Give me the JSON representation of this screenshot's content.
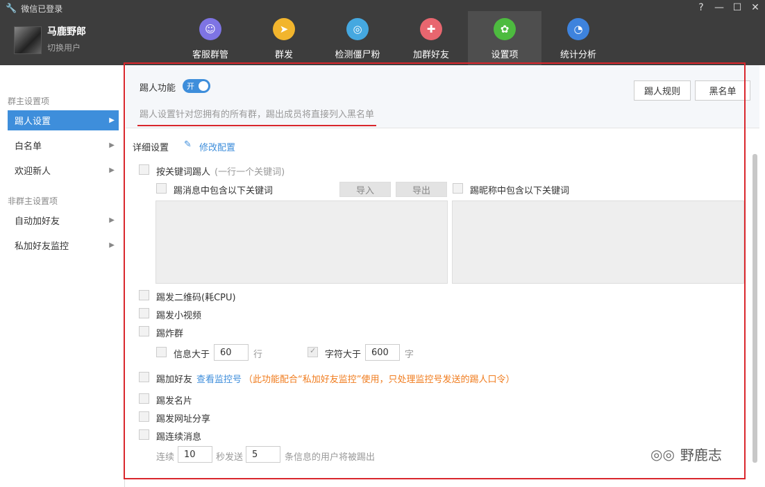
{
  "window": {
    "title": "微信已登录",
    "ctrl_help": "?",
    "ctrl_min": "—",
    "ctrl_max": "☐",
    "ctrl_close": "✕"
  },
  "user": {
    "name": "马鹿野郎",
    "switch": "切换用户"
  },
  "nav": [
    {
      "label": "客服群管",
      "color": "#7e74e4",
      "glyph": "☺"
    },
    {
      "label": "群发",
      "color": "#f2b52d",
      "glyph": "➤"
    },
    {
      "label": "检测僵尸粉",
      "color": "#45a8e0",
      "glyph": "◎"
    },
    {
      "label": "加群好友",
      "color": "#e8666f",
      "glyph": "✚"
    },
    {
      "label": "设置项",
      "color": "#4dbb3f",
      "glyph": "✿"
    },
    {
      "label": "统计分析",
      "color": "#3e83dd",
      "glyph": "◔"
    }
  ],
  "sidebar": {
    "group1": "群主设置项",
    "items1": [
      "踢人设置",
      "白名单",
      "欢迎新人"
    ],
    "group2": "非群主设置项",
    "items2": [
      "自动加好友",
      "私加好友监控"
    ]
  },
  "main": {
    "kick_label": "踢人功能",
    "toggle": "开",
    "rules_btn": "踢人规则",
    "blacklist_btn": "黑名单",
    "desc": "踢人设置针对您拥有的所有群，踢出成员将直接列入黑名单",
    "detail_label": "详细设置",
    "edit_label": "修改配置",
    "kw_kick": "按关键词踢人",
    "kw_hint": "(一行一个关键词)",
    "msg_kw": "踢消息中包含以下关键词",
    "import": "导入",
    "export": "导出",
    "nick_kw": "踢昵称中包含以下关键词",
    "qr": "踢发二维码(耗CPU)",
    "video": "踢发小视频",
    "bomb": "踢炸群",
    "info_gt": "信息大于",
    "info_val": "60",
    "row_unit": "行",
    "char_gt": "字符大于",
    "char_val": "600",
    "char_unit": "字",
    "add_friend": "踢加好友",
    "view_monitor": "查看监控号",
    "add_note": "（此功能配合“私加好友监控”使用，只处理监控号发送的踢人口令）",
    "card": "踢发名片",
    "url": "踢发网址分享",
    "cont": "踢连续消息",
    "cont_a": "连续",
    "cont_sec": "10",
    "cont_b": "秒发送",
    "cont_cnt": "5",
    "cont_c": "条信息的用户将被踢出"
  },
  "watermark": "野鹿志"
}
